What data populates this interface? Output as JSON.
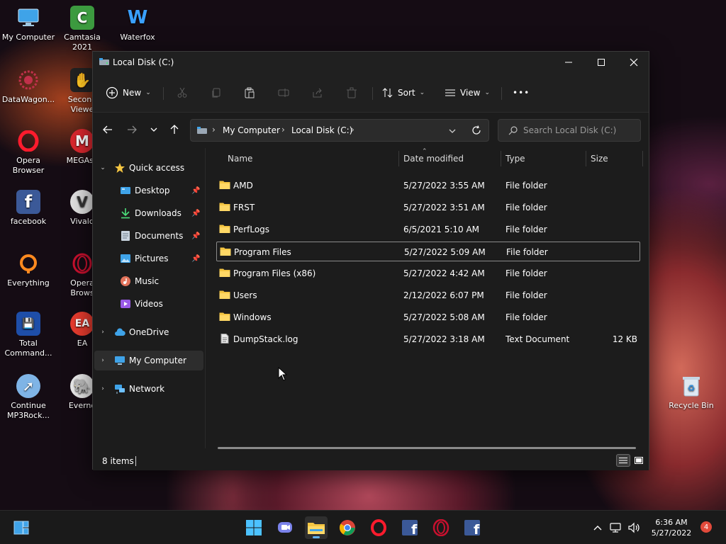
{
  "desktop": {
    "icons": [
      {
        "label": "My Computer",
        "icon": "monitor-icon"
      },
      {
        "label": "Camtasia\n2021",
        "icon": "camtasia-icon"
      },
      {
        "label": "Waterfox",
        "icon": "waterfox-icon"
      },
      {
        "label": "DataWagon...",
        "icon": "datawagon-icon"
      },
      {
        "label": "Second\nViewe",
        "icon": "second-viewer-icon"
      },
      {
        "label": "Opera\nBrowser",
        "icon": "opera-icon"
      },
      {
        "label": "MEGAsy",
        "icon": "mega-icon"
      },
      {
        "label": "facebook",
        "icon": "facebook-icon"
      },
      {
        "label": "Vivald",
        "icon": "vivaldi-icon"
      },
      {
        "label": "Everything",
        "icon": "everything-icon"
      },
      {
        "label": "Opera\nBrows",
        "icon": "opera-gx-icon"
      },
      {
        "label": "Total\nCommand...",
        "icon": "total-commander-icon"
      },
      {
        "label": "EA",
        "icon": "ea-icon"
      },
      {
        "label": "Continue\nMP3Rock...",
        "icon": "mp3rocket-icon"
      },
      {
        "label": "Everno",
        "icon": "evernote-icon"
      },
      {
        "label": "Recycle Bin",
        "icon": "recycle-bin-icon"
      }
    ]
  },
  "window": {
    "title": "Local Disk (C:)",
    "command_bar": {
      "new_label": "New",
      "sort_label": "Sort",
      "view_label": "View",
      "more_label": "•••"
    },
    "address": {
      "crumbs": [
        "My Computer",
        "Local Disk (C:)"
      ]
    },
    "search": {
      "placeholder": "Search Local Disk (C:)"
    },
    "nav_pane": {
      "quick_access": "Quick access",
      "items": [
        {
          "label": "Desktop",
          "icon": "desktop-folder-icon",
          "pinned": true
        },
        {
          "label": "Downloads",
          "icon": "download-icon",
          "pinned": true
        },
        {
          "label": "Documents",
          "icon": "documents-icon",
          "pinned": true
        },
        {
          "label": "Pictures",
          "icon": "pictures-icon",
          "pinned": true
        },
        {
          "label": "Music",
          "icon": "music-icon",
          "pinned": false
        },
        {
          "label": "Videos",
          "icon": "videos-icon",
          "pinned": false
        }
      ],
      "onedrive": "OneDrive",
      "my_computer": "My Computer",
      "network": "Network"
    },
    "columns": {
      "name": "Name",
      "date": "Date modified",
      "type": "Type",
      "size": "Size"
    },
    "files": [
      {
        "name": "AMD",
        "date": "5/27/2022 3:55 AM",
        "type": "File folder",
        "size": "",
        "kind": "folder"
      },
      {
        "name": "FRST",
        "date": "5/27/2022 3:51 AM",
        "type": "File folder",
        "size": "",
        "kind": "folder"
      },
      {
        "name": "PerfLogs",
        "date": "6/5/2021 5:10 AM",
        "type": "File folder",
        "size": "",
        "kind": "folder"
      },
      {
        "name": "Program Files",
        "date": "5/27/2022 5:09 AM",
        "type": "File folder",
        "size": "",
        "kind": "folder"
      },
      {
        "name": "Program Files (x86)",
        "date": "5/27/2022 4:42 AM",
        "type": "File folder",
        "size": "",
        "kind": "folder"
      },
      {
        "name": "Users",
        "date": "2/12/2022 6:07 PM",
        "type": "File folder",
        "size": "",
        "kind": "folder"
      },
      {
        "name": "Windows",
        "date": "5/27/2022 5:08 AM",
        "type": "File folder",
        "size": "",
        "kind": "folder"
      },
      {
        "name": "DumpStack.log",
        "date": "5/27/2022 3:18 AM",
        "type": "Text Document",
        "size": "12 KB",
        "kind": "file"
      }
    ],
    "status": {
      "count": "8 items"
    }
  },
  "taskbar": {
    "time": "6:36 AM",
    "date": "5/27/2022",
    "notification_count": "4"
  },
  "colors": {
    "folder": "#f4c542",
    "accent": "#5fb2f2",
    "window_bg": "#1c1c1c"
  }
}
